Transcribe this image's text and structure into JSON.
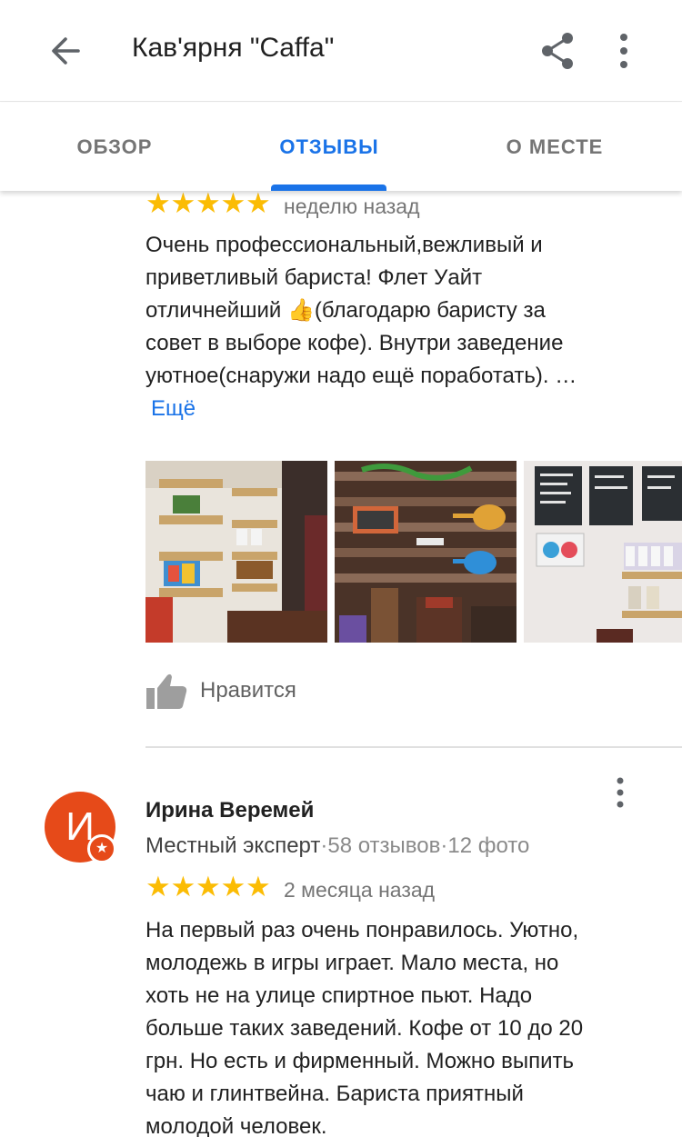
{
  "header": {
    "title": "Кав'ярня \"Caffa\""
  },
  "tabs": [
    {
      "label": "ОБЗОР",
      "active": false
    },
    {
      "label": "ОТЗЫВЫ",
      "active": true
    },
    {
      "label": "О МЕСТЕ",
      "active": false
    }
  ],
  "reviews": [
    {
      "rating": 5,
      "date": "неделю назад",
      "text": "Очень профессиональный,вежливый и\nприветливый бариста! Флет Уайт\nотличнейший 👍(благодарю баристу за\nсовет в выборе кофе). Внутри заведение\nуютное(снаружи надо ещё поработать). …",
      "more_label": "Ещё",
      "photos": [
        "photo-shelves",
        "photo-pallet-wall",
        "photo-menu-boards"
      ],
      "like_label": "Нравится"
    },
    {
      "avatar_letter": "И",
      "author": "Ирина Веремей",
      "guide": "Местный эксперт",
      "separator": "·",
      "reviews_count": "58 отзывов",
      "photos_count": "12 фото",
      "rating": 5,
      "date": "2 месяца назад",
      "text": "На первый раз очень понравилось. Уютно,\nмолодежь в игры играет. Мало места, но\nхоть не на улице спиртное пьют. Надо\nбольше таких заведений. Кофе от 10 до 20\nгрн. Но есть и фирменный. Можно выпить\nчаю и глинтвейна. Бариста приятный\nмолодой человек."
    }
  ],
  "colors": {
    "accent": "#1a73e8",
    "star": "#fbbc04",
    "avatar": "#e64a19"
  },
  "icons": {
    "back": "arrow-back-icon",
    "share": "share-icon",
    "more": "more-vert-icon",
    "like": "thumb-up-icon",
    "star": "star-icon",
    "badge": "local-guide-star-icon"
  }
}
